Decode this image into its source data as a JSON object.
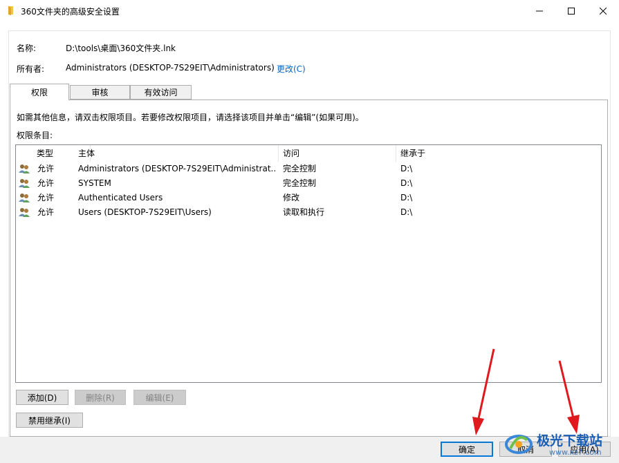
{
  "window": {
    "title": "360文件夹的高级安全设置",
    "icons": {
      "app": "folder-icon",
      "minimize": "minimize-icon",
      "maximize": "maximize-icon",
      "close": "close-icon"
    }
  },
  "info": {
    "name_label": "名称:",
    "name_value": "D:\\tools\\桌面\\360文件夹.lnk",
    "owner_label": "所有者:",
    "owner_value": "Administrators (DESKTOP-7S29EIT\\Administrators)",
    "change_link": "更改(C)"
  },
  "tabs": [
    {
      "label": "权限",
      "active": true
    },
    {
      "label": "审核",
      "active": false
    },
    {
      "label": "有效访问",
      "active": false
    }
  ],
  "permissions": {
    "hint": "如需其他信息，请双击权限项目。若要修改权限项目，请选择该项目并单击“编辑”(如果可用)。",
    "entries_label": "权限条目:",
    "columns": [
      "类型",
      "主体",
      "访问",
      "继承于"
    ],
    "rows": [
      {
        "type": "允许",
        "principal": "Administrators (DESKTOP-7S29EIT\\Administrat...",
        "access": "完全控制",
        "inherited": "D:\\"
      },
      {
        "type": "允许",
        "principal": "SYSTEM",
        "access": "完全控制",
        "inherited": "D:\\"
      },
      {
        "type": "允许",
        "principal": "Authenticated Users",
        "access": "修改",
        "inherited": "D:\\"
      },
      {
        "type": "允许",
        "principal": "Users (DESKTOP-7S29EIT\\Users)",
        "access": "读取和执行",
        "inherited": "D:\\"
      }
    ],
    "row_icon": "user-group-icon"
  },
  "buttons": {
    "add": "添加(D)",
    "remove": "删除(R)",
    "edit": "编辑(E)",
    "disable_inheritance": "禁用继承(I)",
    "ok": "确定",
    "cancel": "取消",
    "apply": "应用(A)"
  },
  "watermark": {
    "text": "极光下载站",
    "url": "www.xz7.com"
  },
  "colors": {
    "link": "#0066cc",
    "focus": "#0078d7",
    "arrow": "#e0191f",
    "watermark": "#1a5fb4"
  }
}
